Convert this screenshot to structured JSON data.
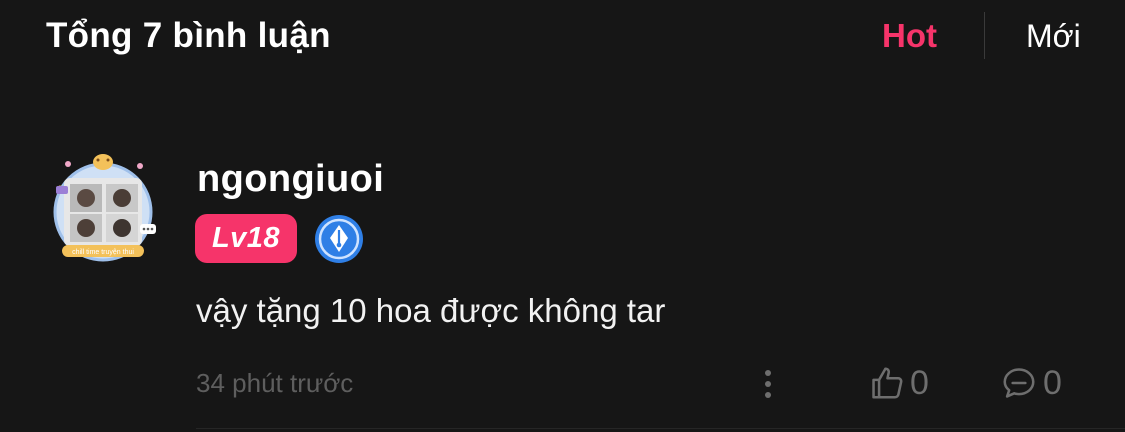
{
  "header": {
    "title": "Tổng 7 bình luận",
    "tabs": [
      {
        "label": "Hot",
        "active": true
      },
      {
        "label": "Mới",
        "active": false
      }
    ]
  },
  "comment": {
    "avatar_icon": "user-avatar-icon",
    "avatar_frame_text": "chill time truyện thui",
    "username": "ngongiuoi",
    "level": "Lv18",
    "badge_icon": "fountain-pen-badge-icon",
    "text": "vậy tặng 10 hoa được không tar",
    "time": "34 phút trước",
    "likes": "0",
    "replies": "0"
  },
  "colors": {
    "background": "#161616",
    "accent": "#f6346a",
    "text_primary": "#ffffff",
    "text_muted": "#5e5e5e",
    "badge_blue": "#2f7fe6"
  }
}
